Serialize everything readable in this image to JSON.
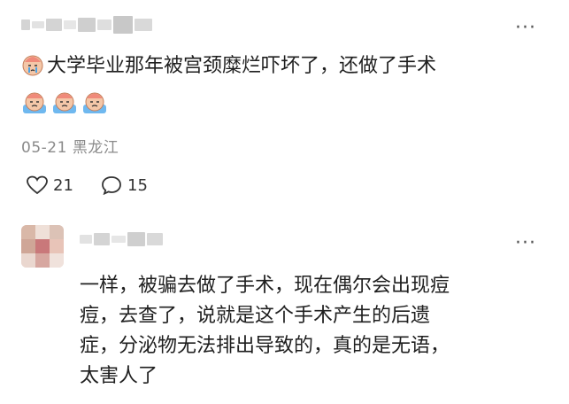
{
  "comments": [
    {
      "text_line1": "大学毕业那年被宫颈糜烂吓坏了，还做了手术",
      "meta_date": "05-21",
      "meta_location": "黑龙江",
      "like_count": "21",
      "reply_count": "15",
      "emoji_name": "crying-face-emoji"
    },
    {
      "text_lines": [
        "一样，被骗去做了手术，现在偶尔会出现痘",
        "痘，去查了，说就是这个手术产生的后遗",
        "症，分泌物无法排出导致的，真的是无语，",
        "太害人了"
      ]
    }
  ],
  "more_glyph": "···",
  "colors": {
    "text": "#1f1f1f",
    "meta": "#8a8a8a",
    "blur": "#d4d4d4"
  }
}
